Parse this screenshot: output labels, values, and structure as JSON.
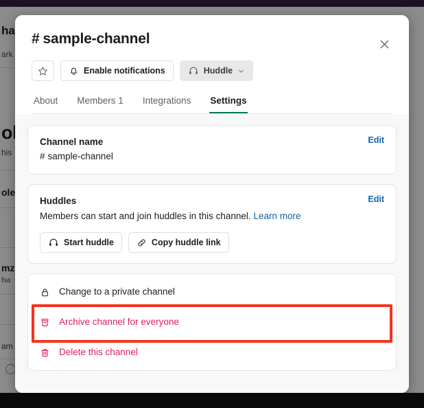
{
  "background": {
    "fragments": [
      "ha",
      "ark",
      "ole",
      "his ",
      "ole",
      "mz",
      "fsa",
      "am"
    ]
  },
  "modal": {
    "title": "sample-channel",
    "title_hash": "#",
    "close_icon": "close-icon",
    "actions": [
      {
        "id": "star",
        "label": "",
        "icon": "star-icon",
        "style": "outline",
        "icon_only": true
      },
      {
        "id": "notifications",
        "label": "Enable notifications",
        "icon": "bell-icon",
        "style": "outline",
        "icon_only": false
      },
      {
        "id": "huddle",
        "label": "Huddle",
        "icon": "headphones-icon",
        "style": "filled",
        "icon_only": false,
        "caret": true
      }
    ],
    "tabs": [
      {
        "label": "About",
        "active": false
      },
      {
        "label": "Members 1",
        "active": false
      },
      {
        "label": "Integrations",
        "active": false
      },
      {
        "label": "Settings",
        "active": true
      }
    ],
    "sections": {
      "channel_name": {
        "label": "Channel name",
        "hash": "#",
        "value": "sample-channel",
        "edit_label": "Edit"
      },
      "huddles": {
        "label": "Huddles",
        "description": "Members can start and join huddles in this channel.",
        "learn_more": "Learn more",
        "edit_label": "Edit",
        "buttons": [
          {
            "label": "Start huddle",
            "icon": "headphones-icon"
          },
          {
            "label": "Copy huddle link",
            "icon": "link-icon"
          }
        ]
      },
      "danger_actions": [
        {
          "label": "Change to a private channel",
          "icon": "lock-icon",
          "danger": false
        },
        {
          "label": "Archive channel for everyone",
          "icon": "archive-icon",
          "danger": true
        },
        {
          "label": "Delete this channel",
          "icon": "trash-icon",
          "danger": true
        }
      ]
    },
    "highlight": {
      "target": "Archive channel for everyone",
      "color": "#f4321a"
    }
  },
  "colors": {
    "accent_green": "#007a5a",
    "link_blue": "#1264a3",
    "danger_pink": "#e01e5a",
    "highlight_red": "#f4321a",
    "titlebar": "#1f1125"
  }
}
